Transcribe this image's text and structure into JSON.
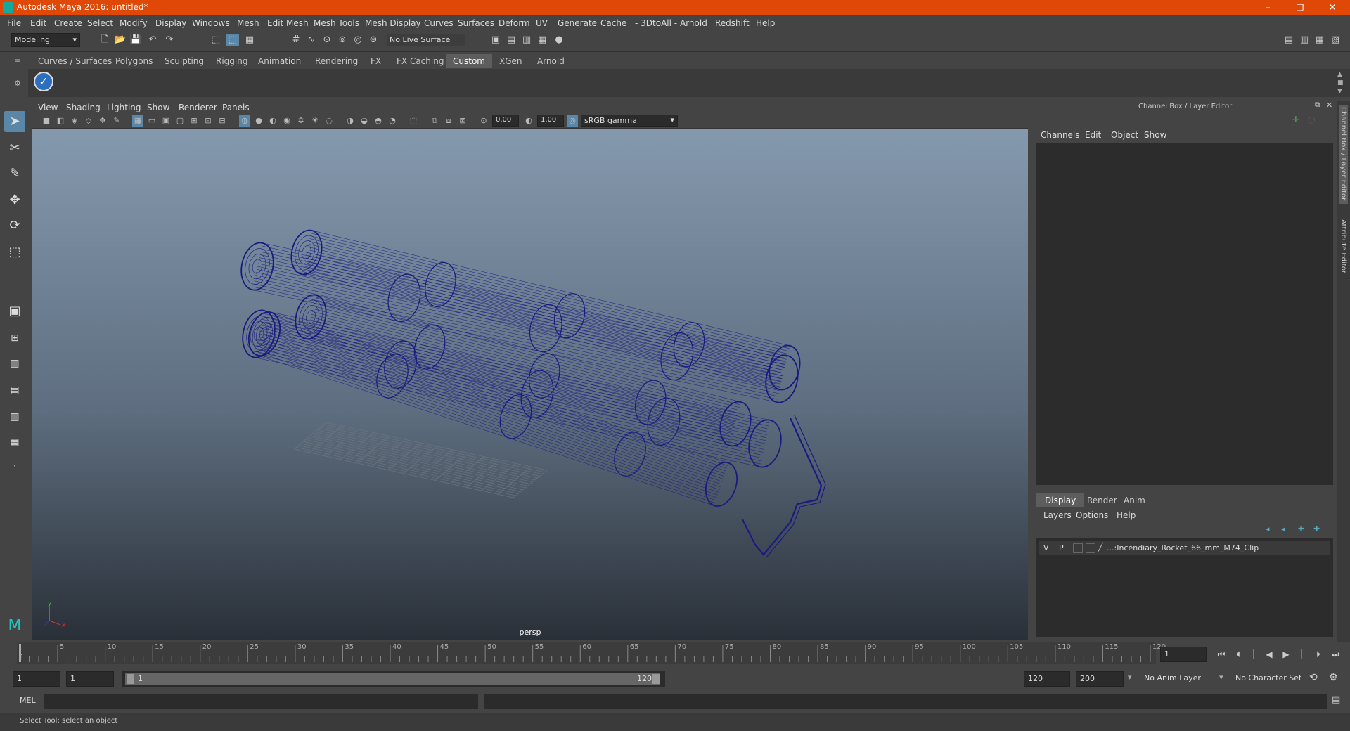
{
  "window": {
    "title": "Autodesk Maya 2016: untitled*",
    "minimize": "–",
    "restore": "❐",
    "close": "✕"
  },
  "menus": [
    "File",
    "Edit",
    "Create",
    "Select",
    "Modify",
    "Display",
    "Windows",
    "Mesh",
    "Edit Mesh",
    "Mesh Tools",
    "Mesh Display",
    "Curves",
    "Surfaces",
    "Deform",
    "UV",
    "Generate",
    "Cache",
    "- 3DtoAll -",
    "Arnold",
    "Redshift",
    "Help"
  ],
  "status": {
    "mode": "Modeling",
    "live_surface": "No Live Surface"
  },
  "shelf_tabs": [
    "Curves / Surfaces",
    "Polygons",
    "Sculpting",
    "Rigging",
    "Animation",
    "Rendering",
    "FX",
    "FX Caching",
    "Custom",
    "XGen",
    "Arnold"
  ],
  "shelf_active": "Custom",
  "viewport": {
    "menus": [
      "View",
      "Shading",
      "Lighting",
      "Show",
      "Renderer",
      "Panels"
    ],
    "exposure": "0.00",
    "gamma": "1.00",
    "colorspace": "sRGB gamma",
    "camera": "persp",
    "axis_y": "y",
    "axis_x": "x"
  },
  "channel_box": {
    "title": "Channel Box / Layer Editor",
    "menus": [
      "Channels",
      "Edit",
      "Object",
      "Show"
    ]
  },
  "layer_editor": {
    "tabs": [
      "Display",
      "Render",
      "Anim"
    ],
    "active_tab": "Display",
    "menus": [
      "Layers",
      "Options",
      "Help"
    ],
    "layer": {
      "v": "V",
      "p": "P",
      "name": "...:Incendiary_Rocket_66_mm_M74_Clip"
    }
  },
  "side_tabs": {
    "channel": "Channel Box / Layer Editor",
    "attribute": "Attribute Editor"
  },
  "timeline": {
    "ticks": [
      "5",
      "10",
      "15",
      "20",
      "25",
      "30",
      "35",
      "40",
      "45",
      "50",
      "55",
      "60",
      "65",
      "70",
      "75",
      "80",
      "85",
      "90",
      "95",
      "100",
      "105",
      "110",
      "115",
      "120"
    ],
    "start_marker": "1",
    "current_frame": "1"
  },
  "range": {
    "start": "1",
    "playback_start": "1",
    "slider_start": "1",
    "slider_end": "120",
    "playback_end": "120",
    "end": "200",
    "anim_layer": "No Anim Layer",
    "character_set": "No Character Set"
  },
  "cmdline": {
    "label": "MEL"
  },
  "helpline": {
    "text": "Select Tool: select an object"
  },
  "colors": {
    "titlebar": "#e04808",
    "accent": "#5a87a8",
    "wire": "#1a1a80"
  }
}
